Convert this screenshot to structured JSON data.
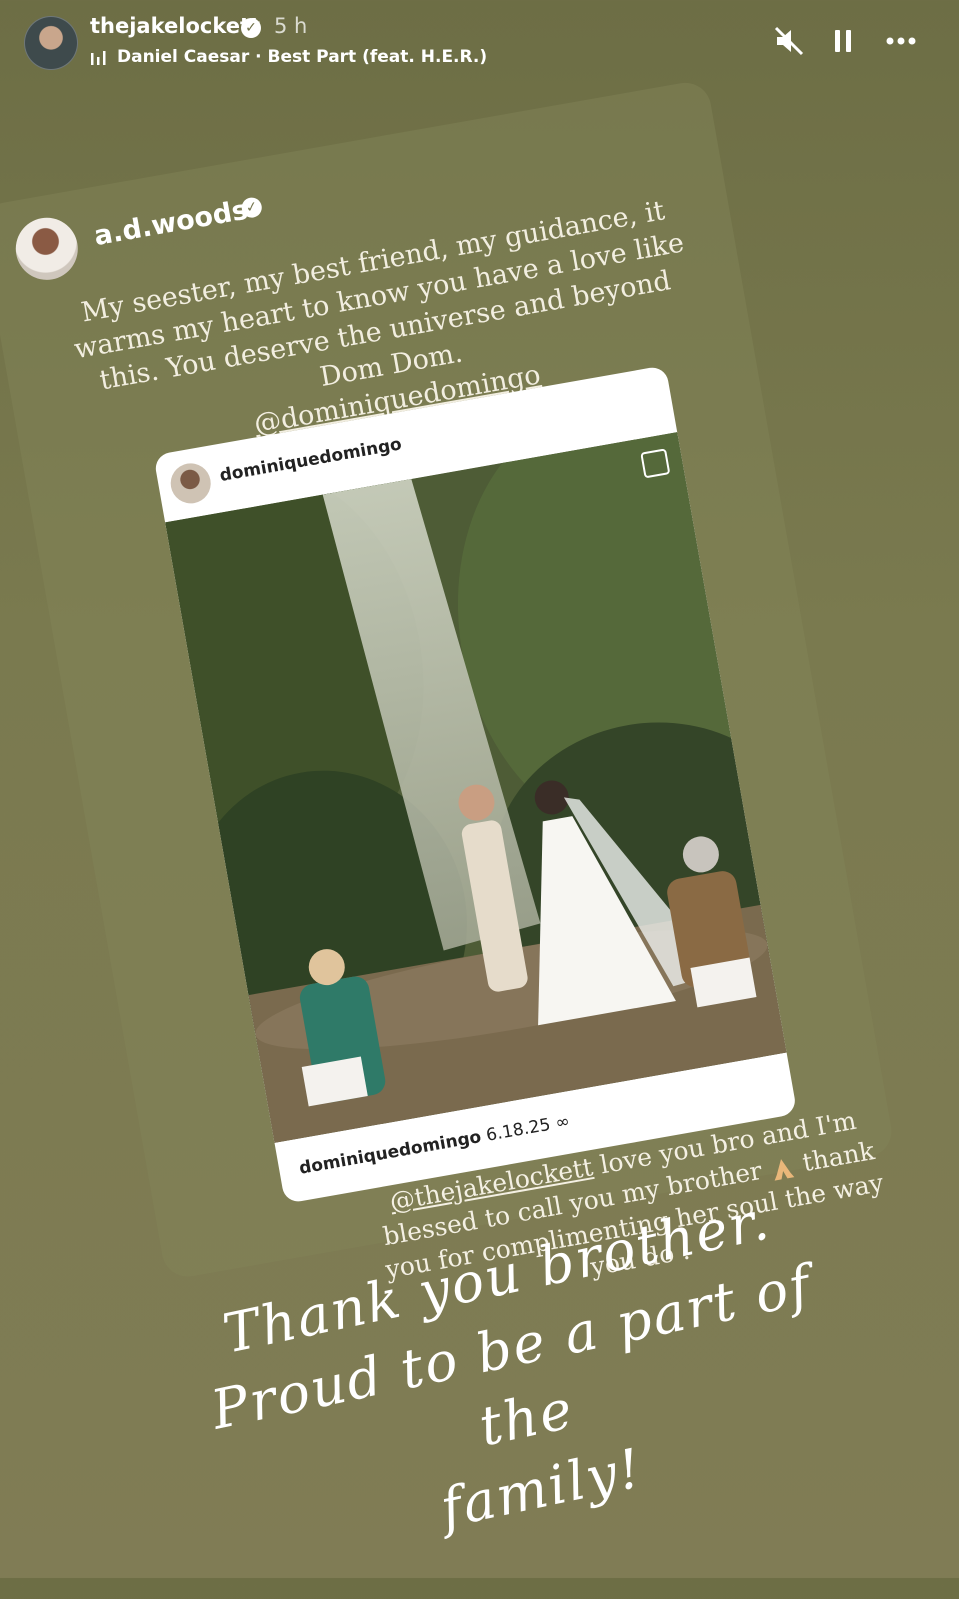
{
  "header": {
    "username": "thejakelockett",
    "verified_mark": "✓",
    "time": "5 h",
    "music": "Daniel Caesar · Best Part (feat. H.E.R.)",
    "icons": [
      "muted-speaker-icon",
      "pause-icon",
      "more-options-icon"
    ]
  },
  "shared_story": {
    "username": "a.d.woods",
    "verified_mark": "✓",
    "caption": "My seester, my best friend, my guidance, it warms my heart to know you have a love like this.  You deserve the universe and beyond Dom Dom.",
    "mention": "@dominiquedomingo"
  },
  "post": {
    "username": "dominiquedomingo",
    "footer_user": "dominiquedomingo",
    "footer_text": "6.18.25 ∞"
  },
  "reply_caption": {
    "mention": "@thejakelockett",
    "text_a": " love you bro and I'm blessed to call you my brother ",
    "text_b": " thank you for complimenting her soul the way you do ."
  },
  "overlay_text": {
    "line1": "Thank you brother.",
    "line2": "Proud to be a part of the",
    "line3": "family!"
  }
}
